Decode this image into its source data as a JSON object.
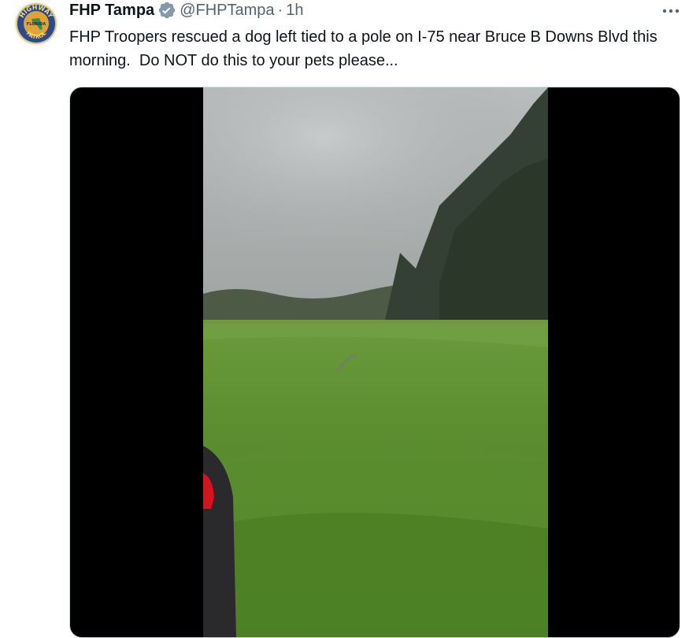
{
  "tweet": {
    "display_name": "FHP Tampa",
    "handle": "@FHPTampa",
    "separator": "·",
    "time": "1h",
    "text": "FHP Troopers rescued a dog left tied to a pole on I-75 near Bruce B Downs Blvd this morning.  Do NOT do this to your pets please...",
    "verified_icon": "verified-badge-icon",
    "verified_color": "#829aab",
    "more_icon": "more-options-icon"
  },
  "avatar": {
    "ring_top": "HIGHWAY",
    "ring_bottom": "PATROL",
    "center": "FLORIDA",
    "ring_color": "#2c4a8a",
    "inner_color": "#e0a33a"
  },
  "media": {
    "type": "video",
    "background": "#000000"
  }
}
